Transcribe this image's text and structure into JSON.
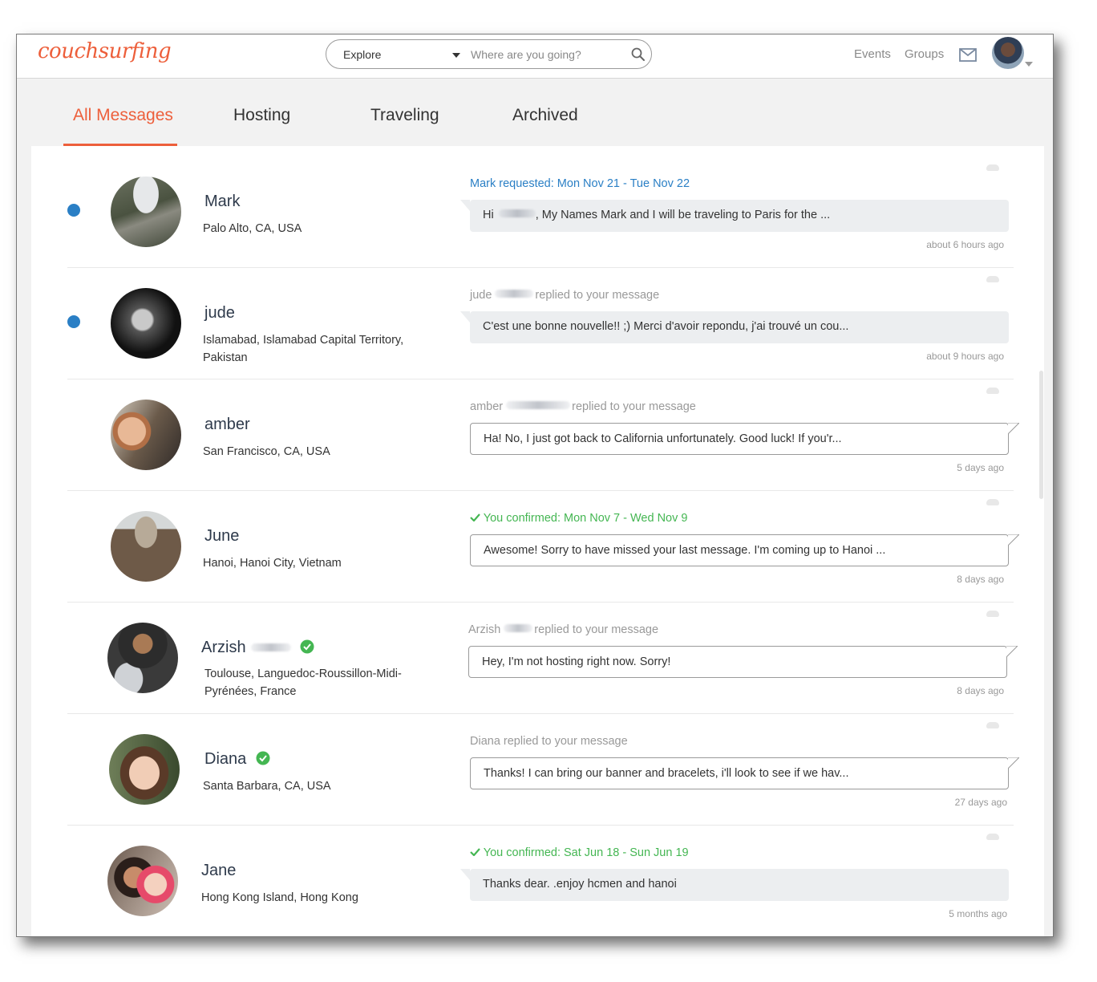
{
  "header": {
    "logo": "couchsurfing",
    "explore_label": "Explore",
    "search_placeholder": "Where are you going?",
    "nav": {
      "events": "Events",
      "groups": "Groups"
    }
  },
  "tabs": [
    {
      "label": "All Messages",
      "active": true
    },
    {
      "label": "Hosting",
      "active": false
    },
    {
      "label": "Traveling",
      "active": false
    },
    {
      "label": "Archived",
      "active": false
    }
  ],
  "colors": {
    "brand": "#ed5f3b",
    "link_blue": "#2a7fc5",
    "confirm_green": "#44b652"
  },
  "messages": [
    {
      "name": "Mark",
      "location": "Palo Alto, CA, USA",
      "unread": true,
      "status_prefix": "Mark requested: Mon Nov 21 - Tue Nov 22",
      "preview_start": "Hi",
      "preview": "My Names Mark and I will be traveling to Paris for the ...",
      "time": "about 6 hours ago"
    },
    {
      "name": "jude",
      "location": "Islamabad, Islamabad Capital Territory, Pakistan",
      "unread": true,
      "status_prefix": "jude",
      "status_suffix": "replied to your message",
      "preview": "C'est une bonne nouvelle!! ;) Merci d'avoir repondu, j'ai trouvé un cou...",
      "time": "about 9 hours ago"
    },
    {
      "name": "amber",
      "location": "San Francisco, CA, USA",
      "unread": false,
      "status_prefix": "amber",
      "status_suffix": "replied to your message",
      "preview": "Ha! No, I just got back to California unfortunately. Good luck! If you'r...",
      "time": "5 days ago"
    },
    {
      "name": "June",
      "location": "Hanoi, Hanoi City, Vietnam",
      "unread": false,
      "status_prefix": "You confirmed: Mon Nov 7 - Wed Nov 9",
      "preview": "Awesome! Sorry to have missed your last message. I'm coming up to Hanoi ...",
      "time": "8 days ago"
    },
    {
      "name": "Arzish",
      "location": "Toulouse, Languedoc-Roussillon-Midi-Pyrénées, France",
      "unread": false,
      "status_prefix": "Arzish",
      "status_suffix": "replied to your message",
      "preview": "Hey, I'm not hosting right now. Sorry!",
      "time": "8 days ago"
    },
    {
      "name": "Diana",
      "location": "Santa Barbara, CA, USA",
      "unread": false,
      "status_prefix": "Diana replied to your message",
      "preview": "Thanks! I can bring our banner and bracelets, i'll look to see if we hav...",
      "time": "27 days ago"
    },
    {
      "name": "Jane",
      "location": "Hong Kong Island, Hong Kong",
      "unread": false,
      "status_prefix": "You confirmed: Sat Jun 18 - Sun Jun 19",
      "preview": "Thanks dear. .enjoy hcmen and hanoi",
      "time": "5 months ago"
    }
  ]
}
